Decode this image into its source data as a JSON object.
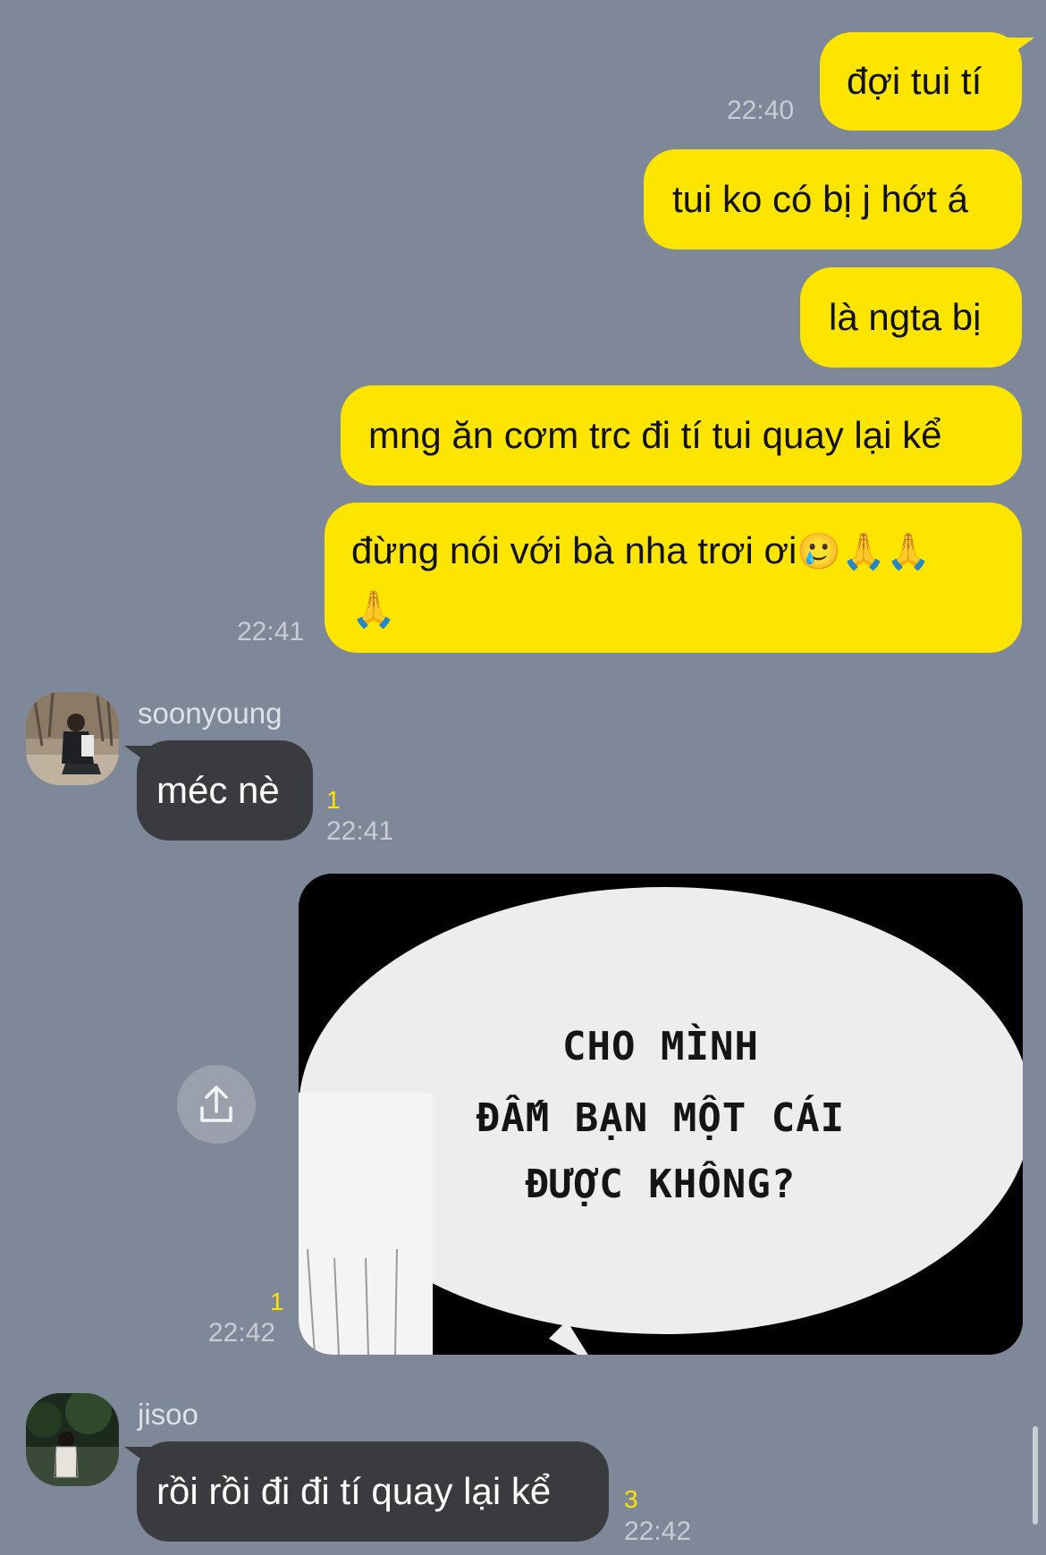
{
  "messages": [
    {
      "type": "outgoing",
      "text": "đợi tui tí",
      "time": "22:40"
    },
    {
      "type": "outgoing",
      "text": "tui ko có bị j hớt á"
    },
    {
      "type": "outgoing",
      "text": "là ngta bị"
    },
    {
      "type": "outgoing",
      "text": "mng ăn cơm trc đi tí tui quay lại kể"
    },
    {
      "type": "outgoing",
      "text": "đừng nói với bà nha trơi ơi",
      "emoji": "🥲🙏🙏",
      "emoji2": "🙏",
      "time": "22:41"
    },
    {
      "type": "incoming",
      "sender": "soonyoung",
      "text": "méc nè",
      "unread": "1",
      "time": "22:41"
    },
    {
      "type": "outgoing-image",
      "image_text": [
        "CHO MÌNH",
        "ĐẤM BẠN MỘT CÁI",
        "ĐƯỢC KHÔNG?"
      ],
      "unread": "1",
      "time": "22:42"
    },
    {
      "type": "incoming",
      "sender": "jisoo",
      "text": "rồi rồi đi đi tí quay lại kể",
      "unread": "3",
      "time": "22:42"
    }
  ],
  "icons": {
    "share": "share-icon"
  },
  "colors": {
    "background": "#7f8899",
    "outgoing_bubble": "#fee500",
    "incoming_bubble": "#3a3b3f",
    "unread": "#fee500"
  }
}
